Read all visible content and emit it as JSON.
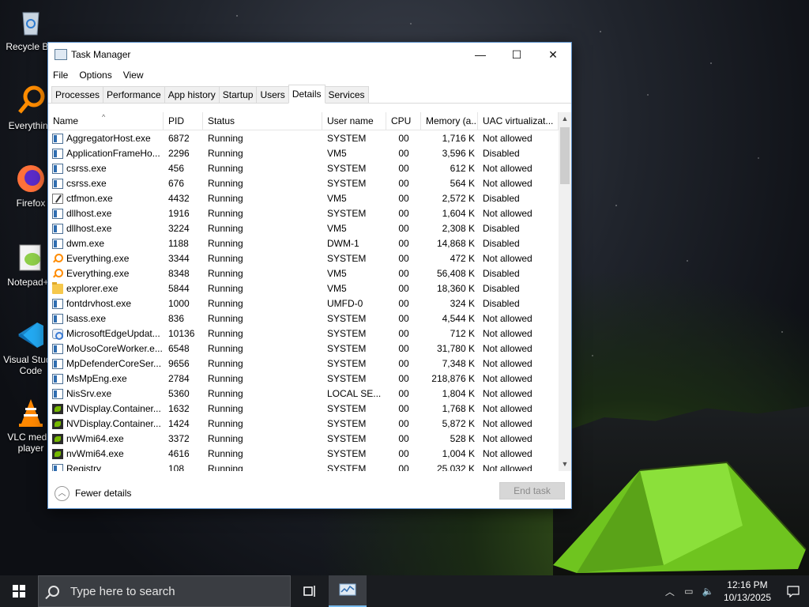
{
  "desktop": {
    "icons": [
      {
        "label": "Recycle Bin"
      },
      {
        "label": "Everything"
      },
      {
        "label": "Firefox"
      },
      {
        "label": "Notepad++"
      },
      {
        "label": "Visual Studio Code"
      },
      {
        "label": "VLC media player"
      }
    ]
  },
  "window": {
    "title": "Task Manager",
    "controls": {
      "minimize": "—",
      "maximize": "☐",
      "close": "✕"
    },
    "menu": [
      "File",
      "Options",
      "View"
    ],
    "tabs": [
      "Processes",
      "Performance",
      "App history",
      "Startup",
      "Users",
      "Details",
      "Services"
    ],
    "active_tab": "Details",
    "columns": [
      "Name",
      "PID",
      "Status",
      "User name",
      "CPU",
      "Memory (a...",
      "UAC virtualizat..."
    ],
    "rows": [
      {
        "icon": "app",
        "name": "AggregatorHost.exe",
        "pid": "6872",
        "status": "Running",
        "user": "SYSTEM",
        "cpu": "00",
        "mem": "1,716 K",
        "uac": "Not allowed"
      },
      {
        "icon": "app",
        "name": "ApplicationFrameHo...",
        "pid": "2296",
        "status": "Running",
        "user": "VM5",
        "cpu": "00",
        "mem": "3,596 K",
        "uac": "Disabled"
      },
      {
        "icon": "app",
        "name": "csrss.exe",
        "pid": "456",
        "status": "Running",
        "user": "SYSTEM",
        "cpu": "00",
        "mem": "612 K",
        "uac": "Not allowed"
      },
      {
        "icon": "app",
        "name": "csrss.exe",
        "pid": "676",
        "status": "Running",
        "user": "SYSTEM",
        "cpu": "00",
        "mem": "564 K",
        "uac": "Not allowed"
      },
      {
        "icon": "pen",
        "name": "ctfmon.exe",
        "pid": "4432",
        "status": "Running",
        "user": "VM5",
        "cpu": "00",
        "mem": "2,572 K",
        "uac": "Disabled"
      },
      {
        "icon": "app",
        "name": "dllhost.exe",
        "pid": "1916",
        "status": "Running",
        "user": "SYSTEM",
        "cpu": "00",
        "mem": "1,604 K",
        "uac": "Not allowed"
      },
      {
        "icon": "app",
        "name": "dllhost.exe",
        "pid": "3224",
        "status": "Running",
        "user": "VM5",
        "cpu": "00",
        "mem": "2,308 K",
        "uac": "Disabled"
      },
      {
        "icon": "app",
        "name": "dwm.exe",
        "pid": "1188",
        "status": "Running",
        "user": "DWM-1",
        "cpu": "00",
        "mem": "14,868 K",
        "uac": "Disabled"
      },
      {
        "icon": "search",
        "name": "Everything.exe",
        "pid": "3344",
        "status": "Running",
        "user": "SYSTEM",
        "cpu": "00",
        "mem": "472 K",
        "uac": "Not allowed"
      },
      {
        "icon": "search",
        "name": "Everything.exe",
        "pid": "8348",
        "status": "Running",
        "user": "VM5",
        "cpu": "00",
        "mem": "56,408 K",
        "uac": "Disabled"
      },
      {
        "icon": "folder",
        "name": "explorer.exe",
        "pid": "5844",
        "status": "Running",
        "user": "VM5",
        "cpu": "00",
        "mem": "18,360 K",
        "uac": "Disabled"
      },
      {
        "icon": "app",
        "name": "fontdrvhost.exe",
        "pid": "1000",
        "status": "Running",
        "user": "UMFD-0",
        "cpu": "00",
        "mem": "324 K",
        "uac": "Disabled"
      },
      {
        "icon": "app",
        "name": "lsass.exe",
        "pid": "836",
        "status": "Running",
        "user": "SYSTEM",
        "cpu": "00",
        "mem": "4,544 K",
        "uac": "Not allowed"
      },
      {
        "icon": "gear",
        "name": "MicrosoftEdgeUpdat...",
        "pid": "10136",
        "status": "Running",
        "user": "SYSTEM",
        "cpu": "00",
        "mem": "712 K",
        "uac": "Not allowed"
      },
      {
        "icon": "app",
        "name": "MoUsoCoreWorker.e...",
        "pid": "6548",
        "status": "Running",
        "user": "SYSTEM",
        "cpu": "00",
        "mem": "31,780 K",
        "uac": "Not allowed"
      },
      {
        "icon": "app",
        "name": "MpDefenderCoreSer...",
        "pid": "9656",
        "status": "Running",
        "user": "SYSTEM",
        "cpu": "00",
        "mem": "7,348 K",
        "uac": "Not allowed"
      },
      {
        "icon": "app",
        "name": "MsMpEng.exe",
        "pid": "2784",
        "status": "Running",
        "user": "SYSTEM",
        "cpu": "00",
        "mem": "218,876 K",
        "uac": "Not allowed"
      },
      {
        "icon": "app",
        "name": "NisSrv.exe",
        "pid": "5360",
        "status": "Running",
        "user": "LOCAL SE...",
        "cpu": "00",
        "mem": "1,804 K",
        "uac": "Not allowed"
      },
      {
        "icon": "nv",
        "name": "NVDisplay.Container...",
        "pid": "1632",
        "status": "Running",
        "user": "SYSTEM",
        "cpu": "00",
        "mem": "1,768 K",
        "uac": "Not allowed"
      },
      {
        "icon": "nv",
        "name": "NVDisplay.Container...",
        "pid": "1424",
        "status": "Running",
        "user": "SYSTEM",
        "cpu": "00",
        "mem": "5,872 K",
        "uac": "Not allowed"
      },
      {
        "icon": "nv",
        "name": "nvWmi64.exe",
        "pid": "3372",
        "status": "Running",
        "user": "SYSTEM",
        "cpu": "00",
        "mem": "528 K",
        "uac": "Not allowed"
      },
      {
        "icon": "nv",
        "name": "nvWmi64.exe",
        "pid": "4616",
        "status": "Running",
        "user": "SYSTEM",
        "cpu": "00",
        "mem": "1,004 K",
        "uac": "Not allowed"
      },
      {
        "icon": "app",
        "name": "Registry",
        "pid": "108",
        "status": "Running",
        "user": "SYSTEM",
        "cpu": "00",
        "mem": "25,032 K",
        "uac": "Not allowed"
      }
    ],
    "footer": {
      "fewer_details": "Fewer details",
      "end_task": "End task"
    }
  },
  "taskbar": {
    "search_placeholder": "Type here to search",
    "time": "12:16 PM",
    "date": "10/13/2025"
  },
  "colors": {
    "accent": "#76b9ed",
    "window_border": "#5a8fc9"
  }
}
